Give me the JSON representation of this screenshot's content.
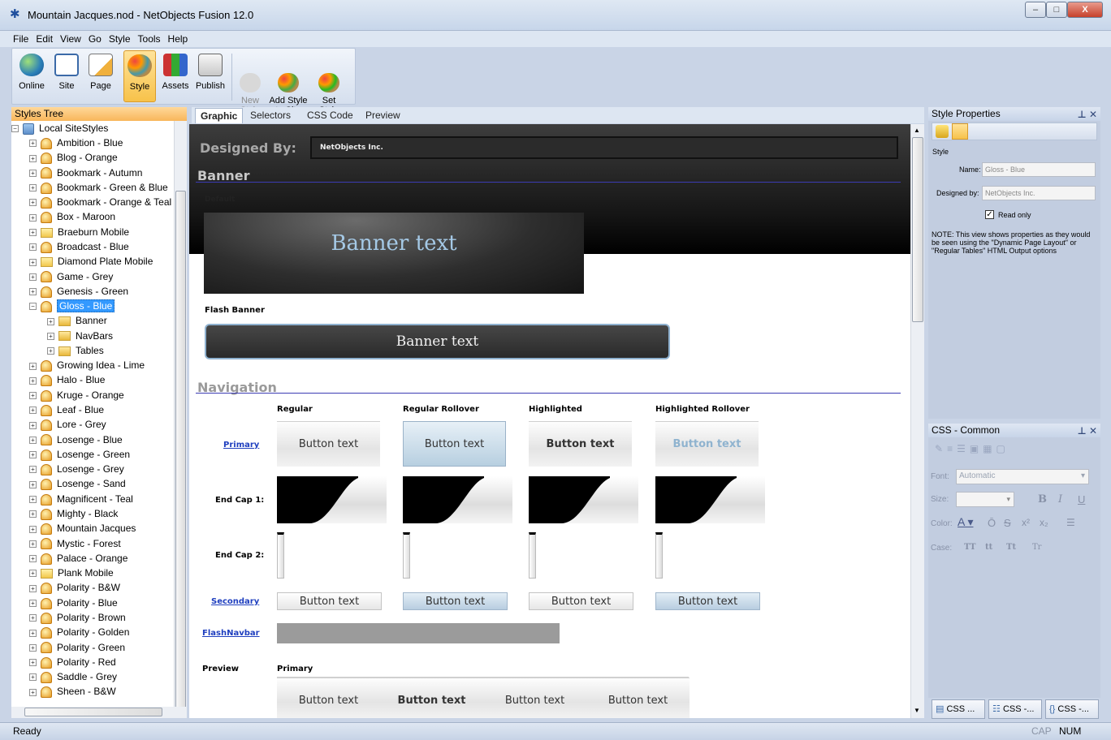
{
  "window": {
    "title": "Mountain Jacques.nod - NetObjects Fusion 12.0",
    "buttons": {
      "minimize": "–",
      "maximize": "□",
      "close": "X"
    }
  },
  "menu": [
    "File",
    "Edit",
    "View",
    "Go",
    "Style",
    "Tools",
    "Help"
  ],
  "toolbar": [
    {
      "label": "Online",
      "icon": "globe-icon"
    },
    {
      "label": "Site",
      "icon": "sitemap-icon"
    },
    {
      "label": "Page",
      "icon": "page-edit-icon"
    },
    {
      "label": "Style",
      "icon": "palette-icon",
      "active": true
    },
    {
      "label": "Assets",
      "icon": "assets-icon"
    },
    {
      "label": "Publish",
      "icon": "publish-icon"
    },
    {
      "label": "New\nStyle",
      "icon": "new-style-icon",
      "disabled": true
    },
    {
      "label": "Add Style\nto Site",
      "icon": "add-style-icon"
    },
    {
      "label": "Set\nStyle",
      "icon": "set-style-icon"
    }
  ],
  "styles_tree": {
    "header": "Styles Tree",
    "root": "Local SiteStyles",
    "items": [
      {
        "label": "Ambition - Blue",
        "type": "style"
      },
      {
        "label": "Blog - Orange",
        "type": "style"
      },
      {
        "label": "Bookmark - Autumn",
        "type": "style"
      },
      {
        "label": "Bookmark - Green & Blue",
        "type": "style"
      },
      {
        "label": "Bookmark - Orange & Teal",
        "type": "style"
      },
      {
        "label": "Box - Maroon",
        "type": "style"
      },
      {
        "label": "Braeburn Mobile",
        "type": "folder"
      },
      {
        "label": "Broadcast - Blue",
        "type": "style"
      },
      {
        "label": "Diamond Plate Mobile",
        "type": "folder"
      },
      {
        "label": "Game - Grey",
        "type": "style"
      },
      {
        "label": "Genesis - Green",
        "type": "style"
      },
      {
        "label": "Gloss - Blue",
        "type": "style",
        "selected": true,
        "expanded": true
      },
      {
        "label": "Banner",
        "type": "child"
      },
      {
        "label": "NavBars",
        "type": "child"
      },
      {
        "label": "Tables",
        "type": "child"
      },
      {
        "label": "Growing Idea - Lime",
        "type": "style"
      },
      {
        "label": "Halo - Blue",
        "type": "style"
      },
      {
        "label": "Kruge - Orange",
        "type": "style"
      },
      {
        "label": "Leaf - Blue",
        "type": "style"
      },
      {
        "label": "Lore - Grey",
        "type": "style"
      },
      {
        "label": "Losenge - Blue",
        "type": "style"
      },
      {
        "label": "Losenge - Green",
        "type": "style"
      },
      {
        "label": "Losenge - Grey",
        "type": "style"
      },
      {
        "label": "Losenge - Sand",
        "type": "style"
      },
      {
        "label": "Magnificent - Teal",
        "type": "style"
      },
      {
        "label": "Mighty - Black",
        "type": "style"
      },
      {
        "label": "Mountain Jacques",
        "type": "style"
      },
      {
        "label": "Mystic - Forest",
        "type": "style"
      },
      {
        "label": "Palace - Orange",
        "type": "style"
      },
      {
        "label": "Plank Mobile",
        "type": "folder"
      },
      {
        "label": "Polarity - B&W",
        "type": "style"
      },
      {
        "label": "Polarity - Blue",
        "type": "style"
      },
      {
        "label": "Polarity - Brown",
        "type": "style"
      },
      {
        "label": "Polarity - Golden",
        "type": "style"
      },
      {
        "label": "Polarity - Green",
        "type": "style"
      },
      {
        "label": "Polarity - Red",
        "type": "style"
      },
      {
        "label": "Saddle - Grey",
        "type": "style"
      },
      {
        "label": "Sheen - B&W",
        "type": "style"
      }
    ]
  },
  "view_tabs": [
    "Graphic",
    "Selectors",
    "CSS Code",
    "Preview"
  ],
  "graphic": {
    "designed_by_label": "Designed By:",
    "designed_by_value": "NetObjects Inc.",
    "banner_header": "Banner",
    "default_label": "Default",
    "banner_text": "Banner text",
    "flash_banner_label": "Flash Banner",
    "flash_banner_text": "Banner text",
    "navigation_header": "Navigation",
    "columns": [
      "Regular",
      "Regular Rollover",
      "Highlighted",
      "Highlighted Rollover"
    ],
    "rows": {
      "primary": "Primary",
      "endcap1": "End Cap 1:",
      "endcap2": "End Cap 2:",
      "secondary": "Secondary",
      "flashnavbar": "FlashNavbar"
    },
    "button_text": "Button text",
    "preview_label": "Preview",
    "preview_primary_label": "Primary",
    "preview_buttons": [
      "Button text",
      "Button text",
      "Button text",
      "Button text"
    ]
  },
  "style_properties": {
    "header": "Style Properties",
    "section": "Style",
    "name_label": "Name:",
    "name_value": "Gloss - Blue",
    "designed_by_label": "Designed by:",
    "designed_by_value": "NetObjects Inc.",
    "readonly_label": "Read only",
    "note": "NOTE: This view shows properties as they would be seen using the \"Dynamic Page Layout\" or \"Regular Tables\" HTML Output options"
  },
  "css_common": {
    "header": "CSS - Common",
    "font_label": "Font:",
    "font_value": "Automatic",
    "size_label": "Size:",
    "color_label": "Color:",
    "case_label": "Case:",
    "bold": "B",
    "italic": "I",
    "underline": "U",
    "overline": "Ō",
    "strike": "S",
    "superscript": "x²",
    "subscript": "x₂",
    "case_options": [
      "TT",
      "tt",
      "Tt",
      "Tr"
    ]
  },
  "bottom_tabs": [
    "CSS ...",
    "CSS -...",
    "CSS -..."
  ],
  "status": {
    "text": "Ready",
    "cap": "CAP",
    "num": "NUM"
  }
}
